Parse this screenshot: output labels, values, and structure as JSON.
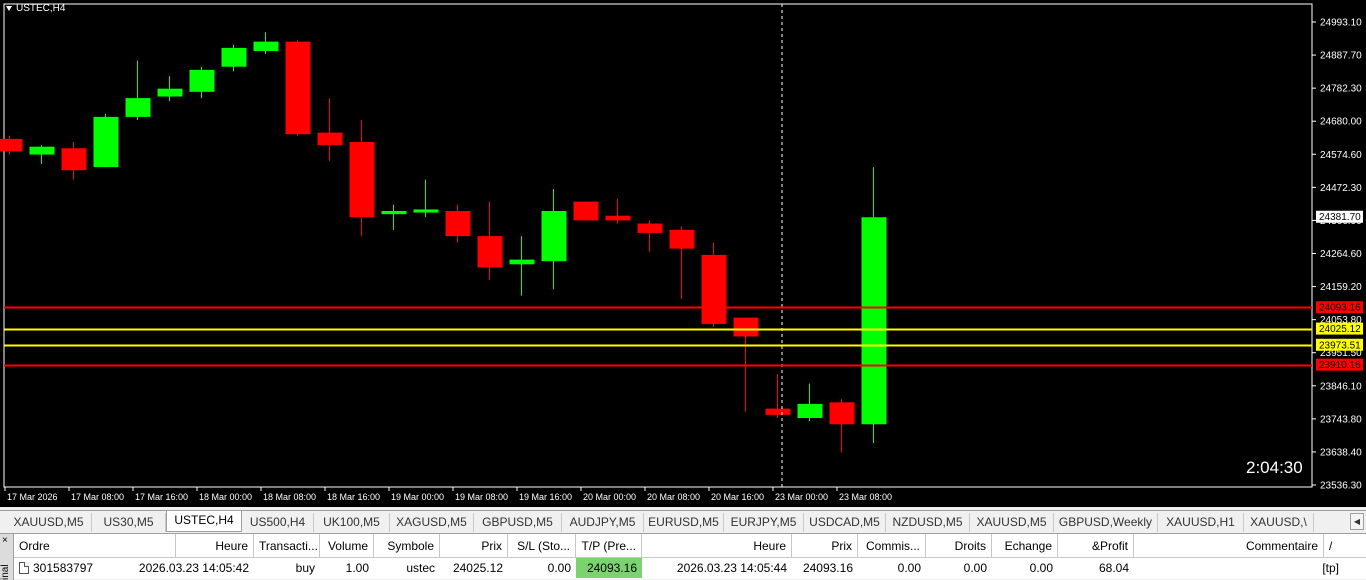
{
  "chart": {
    "symbol": "USTEC,H4",
    "countdown": "2:04:30",
    "colors": {
      "background": "#000000",
      "bull": "#00ff00",
      "bear": "#ff0000",
      "axis_text": "#ffffff",
      "red_line": "#ff0000",
      "yellow_line": "#ffff00"
    },
    "price_axis": [
      "24993.10",
      "24887.70",
      "24782.30",
      "24680.00",
      "24574.60",
      "24472.30",
      "24366.90",
      "24264.60",
      "24159.20",
      "24053.80",
      "23951.50",
      "23846.10",
      "23743.80",
      "23638.40",
      "23536.30"
    ],
    "price_tags": [
      {
        "label": "24381.70",
        "value": 24381.7,
        "bg": "#ffffff",
        "fg": "#000000"
      },
      {
        "label": "24093.16",
        "value": 24093.16,
        "bg": "#ff0000",
        "fg": "#000000"
      },
      {
        "label": "24025.12",
        "value": 24025.12,
        "bg": "#ffff00",
        "fg": "#000000"
      },
      {
        "label": "23973.51",
        "value": 23973.51,
        "bg": "#ffff00",
        "fg": "#000000"
      },
      {
        "label": "23910.16",
        "value": 23910.16,
        "bg": "#ff0000",
        "fg": "#000000"
      }
    ],
    "hlines": [
      {
        "value": 24093.16,
        "color": "#ff0000"
      },
      {
        "value": 24025.12,
        "color": "#ffff00"
      },
      {
        "value": 23973.51,
        "color": "#ffff00"
      },
      {
        "value": 23910.16,
        "color": "#ff0000"
      }
    ],
    "time_axis": [
      "17 Mar 2026",
      "17 Mar 08:00",
      "17 Mar 16:00",
      "18 Mar 00:00",
      "18 Mar 08:00",
      "18 Mar 16:00",
      "19 Mar 00:00",
      "19 Mar 08:00",
      "19 Mar 16:00",
      "20 Mar 00:00",
      "20 Mar 08:00",
      "20 Mar 16:00",
      "23 Mar 00:00",
      "23 Mar 08:00"
    ]
  },
  "chart_data": {
    "type": "candlestick",
    "title": "USTEC,H4",
    "ylim": [
      23520,
      25060
    ],
    "candles": [
      {
        "o": 24630,
        "h": 24640,
        "l": 24580,
        "c": 24590
      },
      {
        "o": 24580,
        "h": 24610,
        "l": 24550,
        "c": 24605
      },
      {
        "o": 24600,
        "h": 24620,
        "l": 24500,
        "c": 24530
      },
      {
        "o": 24540,
        "h": 24710,
        "l": 24540,
        "c": 24700
      },
      {
        "o": 24700,
        "h": 24880,
        "l": 24690,
        "c": 24760
      },
      {
        "o": 24765,
        "h": 24830,
        "l": 24750,
        "c": 24790
      },
      {
        "o": 24780,
        "h": 24860,
        "l": 24760,
        "c": 24850
      },
      {
        "o": 24860,
        "h": 24930,
        "l": 24845,
        "c": 24920
      },
      {
        "o": 24910,
        "h": 24970,
        "l": 24900,
        "c": 24940
      },
      {
        "o": 24940,
        "h": 24945,
        "l": 24640,
        "c": 24645
      },
      {
        "o": 24650,
        "h": 24760,
        "l": 24560,
        "c": 24610
      },
      {
        "o": 24620,
        "h": 24690,
        "l": 24320,
        "c": 24380
      },
      {
        "o": 24390,
        "h": 24420,
        "l": 24340,
        "c": 24400
      },
      {
        "o": 24395,
        "h": 24500,
        "l": 24380,
        "c": 24405
      },
      {
        "o": 24400,
        "h": 24420,
        "l": 24300,
        "c": 24320
      },
      {
        "o": 24320,
        "h": 24430,
        "l": 24180,
        "c": 24220
      },
      {
        "o": 24230,
        "h": 24320,
        "l": 24130,
        "c": 24245
      },
      {
        "o": 24240,
        "h": 24470,
        "l": 24150,
        "c": 24400
      },
      {
        "o": 24430,
        "h": 24430,
        "l": 24370,
        "c": 24370
      },
      {
        "o": 24385,
        "h": 24440,
        "l": 24360,
        "c": 24370
      },
      {
        "o": 24360,
        "h": 24370,
        "l": 24270,
        "c": 24330
      },
      {
        "o": 24340,
        "h": 24350,
        "l": 24120,
        "c": 24280
      },
      {
        "o": 24260,
        "h": 24300,
        "l": 24030,
        "c": 24040
      },
      {
        "o": 24060,
        "h": 24060,
        "l": 23760,
        "c": 24000
      },
      {
        "o": 23770,
        "h": 23880,
        "l": 23740,
        "c": 23750
      },
      {
        "o": 23740,
        "h": 23850,
        "l": 23730,
        "c": 23785
      },
      {
        "o": 23790,
        "h": 23800,
        "l": 23630,
        "c": 23720
      },
      {
        "o": 23720,
        "h": 24540,
        "l": 23660,
        "c": 24380
      }
    ],
    "crosshair_index": 24
  },
  "tabs": [
    {
      "label": "XAUUSD,M5",
      "active": false
    },
    {
      "label": "US30,M5",
      "active": false
    },
    {
      "label": "USTEC,H4",
      "active": true
    },
    {
      "label": "US500,H4",
      "active": false
    },
    {
      "label": "UK100,M5",
      "active": false
    },
    {
      "label": "XAGUSD,M5",
      "active": false
    },
    {
      "label": "GBPUSD,M5",
      "active": false
    },
    {
      "label": "AUDJPY,M5",
      "active": false
    },
    {
      "label": "EURUSD,M5",
      "active": false
    },
    {
      "label": "EURJPY,M5",
      "active": false
    },
    {
      "label": "USDCAD,M5",
      "active": false
    },
    {
      "label": "NZDUSD,M5",
      "active": false
    },
    {
      "label": "XAUUSD,M5",
      "active": false
    },
    {
      "label": "GBPUSD,Weekly",
      "active": false
    },
    {
      "label": "XAUUSD,H1",
      "active": false
    },
    {
      "label": "XAUUSD,\\",
      "active": false
    }
  ],
  "terminal": {
    "side_close": "×",
    "side_label": "inal",
    "headers": [
      "Ordre",
      "Heure",
      "Transacti...",
      "Volume",
      "Symbole",
      "Prix",
      "S/L (Sto...",
      "T/P (Pre...",
      "Heure",
      "Prix",
      "Commis...",
      "Droits",
      "Echange",
      "&Profit",
      "Commentaire"
    ],
    "row": {
      "ordre": "301583797",
      "heure_open": "2026.03.23 14:05:42",
      "type": "buy",
      "volume": "1.00",
      "symbole": "ustec",
      "prix_open": "24025.12",
      "sl": "0.00",
      "tp": "24093.16",
      "heure_close": "2026.03.23 14:05:44",
      "prix_close": "24093.16",
      "commission": "0.00",
      "droits": "0.00",
      "echange": "0.00",
      "profit": "68.04",
      "commentaire": "[tp]"
    },
    "sort_indicator": "/"
  }
}
